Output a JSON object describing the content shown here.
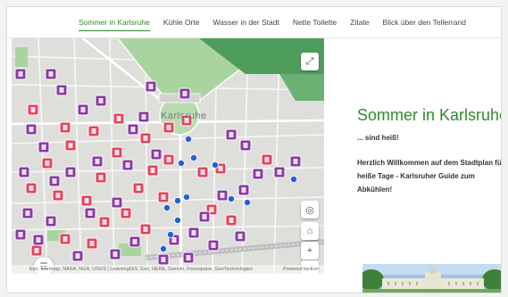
{
  "nav": {
    "items": [
      {
        "label": "Sommer in Karlsruhe",
        "active": true
      },
      {
        "label": "Kühle Orte",
        "active": false
      },
      {
        "label": "Wasser in der Stadt",
        "active": false
      },
      {
        "label": "Nette Toilette",
        "active": false
      },
      {
        "label": "Zitate",
        "active": false
      },
      {
        "label": "Blick über den Tellerrand",
        "active": false
      }
    ]
  },
  "map": {
    "city_label": "Karlsruhe",
    "attribution": "Esri, Intermap, NASA, NGA, USGS | LearningGIS, Esri, HERE, Garmin, Foursquare, GeoTechnologies",
    "powered_by": "Powered by Esri",
    "controls": {
      "expand": "⤢",
      "locate": "◎",
      "home": "⌂",
      "zoom_in": "+",
      "zoom_out": "−",
      "legend": "☰"
    },
    "colors": {
      "toilet_marker": "#e8415c",
      "cool_place_marker": "#8a3aa6",
      "water_point": "#2360d8",
      "park": "#5fb36b"
    }
  },
  "content": {
    "title": "Sommer in Karlsruhe",
    "subtitle": "... sind heiß!",
    "welcome": "Herzlich Willkommen auf dem Stadtplan für heiße Tage - Karlsruher Guide zum Abkühlen!"
  }
}
